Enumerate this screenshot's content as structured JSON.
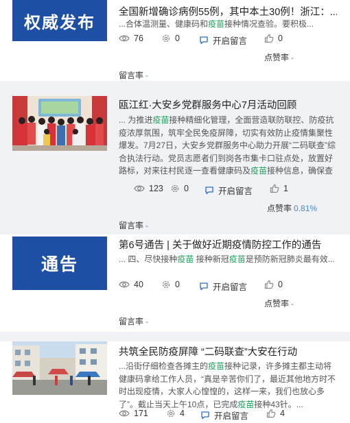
{
  "articles": [
    {
      "thumb_text": "权威发布",
      "title": "全国新增确诊病例55例，其中本土30例！浙江：...",
      "desc": [
        {
          "t": "...合体温测量、健康码和"
        },
        {
          "t": "疫苗",
          "hl": true
        },
        {
          "t": "接种情况查验。要积极..."
        }
      ],
      "views": "76",
      "shares": "0",
      "comment_label": "开启留言",
      "likes": "0",
      "like_rate_label": "点赞率",
      "like_rate_value": "-",
      "comment_rate_label": "留言率",
      "comment_rate_value": "-"
    },
    {
      "title": "瓯江红·大安乡党群服务中心7月活动回顾",
      "desc": [
        {
          "t": "... 为推进"
        },
        {
          "t": "疫苗",
          "hl": true
        },
        {
          "t": "接种精细化管理，全面营造联防联控、防疫抗疫浓厚氛围，筑牢全民免疫屏障，切实有效防止疫情集聚性爆发。7月27日，大安乡党群服务中心助力开展“二码联查”综合执法行动。党员志愿者们到岗各市集卡口驻点处，放置好路标，对来往村民逐一查看健康码及"
        },
        {
          "t": "疫苗",
          "hl": true
        },
        {
          "t": "接种信息，确保查验..."
        }
      ],
      "views": "123",
      "shares": "0",
      "comment_label": "开启留言",
      "likes": "1",
      "like_rate_label": "点赞率",
      "like_rate_value": "0.81%",
      "comment_rate_label": "留言率",
      "comment_rate_value": "-"
    },
    {
      "thumb_text": "通告",
      "title": "第6号通告 | 关于做好近期疫情防控工作的通告",
      "desc": [
        {
          "t": "... 四、尽快接种"
        },
        {
          "t": "疫苗",
          "hl": true
        },
        {
          "t": " 接种新冠"
        },
        {
          "t": "疫苗",
          "hl": true
        },
        {
          "t": "是预防新冠肺炎最有效..."
        }
      ],
      "views": "40",
      "shares": "0",
      "comment_label": "开启留言",
      "likes": "0",
      "like_rate_label": "点赞率",
      "like_rate_value": "-",
      "comment_rate_label": "留言率",
      "comment_rate_value": "-"
    },
    {
      "title": "共筑全民防疫屏障 “二码联查”大安在行动",
      "desc": [
        {
          "t": "...沿街仔细检查各摊主的"
        },
        {
          "t": "疫苗",
          "hl": true
        },
        {
          "t": "接种记录，许多摊主都主动将健康码拿给工作人员，“真是辛苦你们了，最近其他地方时不时出现疫情，大家人心惶惶的，这样一来，我们也放心多了”。截止当天上午10点，已完成"
        },
        {
          "t": "疫苗",
          "hl": true
        },
        {
          "t": "接种43针。..."
        }
      ],
      "views": "171",
      "shares": "4",
      "comment_label": "开启留言",
      "likes": "4"
    }
  ],
  "colors": {
    "accent_green": "#1fa35a",
    "link_blue": "#2b6cc4",
    "thumb_blue": "#1d4fa4",
    "rate_blue": "#4b86c4"
  }
}
